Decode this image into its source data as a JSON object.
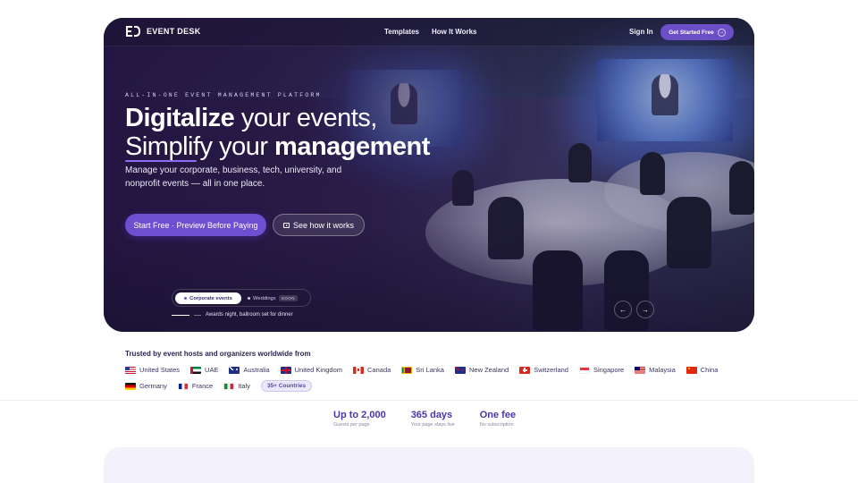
{
  "nav": {
    "brand": "EVENT DESK",
    "links": [
      "Templates",
      "How It Works"
    ],
    "sign_in": "Sign In",
    "cta": "Get Started Free"
  },
  "hero": {
    "eyebrow": "ALL-IN-ONE EVENT MANAGEMENT PLATFORM",
    "headline_bold_1": "Digitalize",
    "headline_thin_1": " your events,",
    "headline_thin_2": "Simplify",
    "headline_thin_3": " your ",
    "headline_bold_2": "management",
    "subtitle": "Manage your corporate, business, tech, university, and nonprofit events — all in one place.",
    "primary_button": "Start Free · Preview Before Paying",
    "secondary_button": "See how it works",
    "tabs": {
      "active": "Corporate events",
      "inactive": "Weddings",
      "soon": "SOON"
    },
    "caption": "Awards night, ballroom set for dinner",
    "prev_arrow": "←",
    "next_arrow": "→"
  },
  "trusted": {
    "title": "Trusted by event hosts and organizers worldwide from",
    "countries": [
      {
        "name": "United States",
        "flag": "us-flag-icon"
      },
      {
        "name": "UAE",
        "flag": "uae-flag-icon"
      },
      {
        "name": "Australia",
        "flag": "australia-flag-icon"
      },
      {
        "name": "United Kingdom",
        "flag": "uk-flag-icon"
      },
      {
        "name": "Canada",
        "flag": "canada-flag-icon"
      },
      {
        "name": "Sri Lanka",
        "flag": "sri-lanka-flag-icon"
      },
      {
        "name": "New Zealand",
        "flag": "new-zealand-flag-icon"
      },
      {
        "name": "Switzerland",
        "flag": "switzerland-flag-icon"
      },
      {
        "name": "Singapore",
        "flag": "singapore-flag-icon"
      },
      {
        "name": "Malaysia",
        "flag": "malaysia-flag-icon"
      },
      {
        "name": "China",
        "flag": "china-flag-icon"
      },
      {
        "name": "Germany",
        "flag": "germany-flag-icon"
      },
      {
        "name": "France",
        "flag": "france-flag-icon"
      },
      {
        "name": "Italy",
        "flag": "italy-flag-icon"
      }
    ],
    "more": "35+ Countries"
  },
  "stats": [
    {
      "value": "Up to 2,000",
      "label": "Guests per page"
    },
    {
      "value": "365 days",
      "label": "Your page stays live"
    },
    {
      "value": "One fee",
      "label": "No subscription"
    }
  ],
  "colors": {
    "accent": "#6d4fd0",
    "hero_dark": "#2a1f45",
    "stat_text": "#4a38a8"
  }
}
